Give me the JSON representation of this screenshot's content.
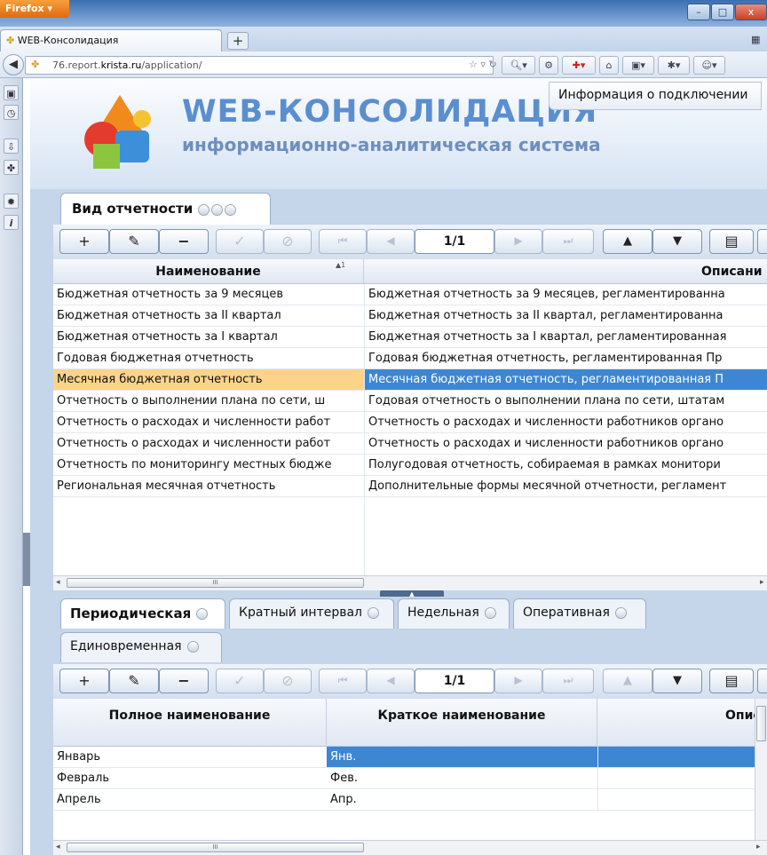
{
  "browser": {
    "menu_label": "Firefox",
    "tab_title": "WEB-Консолидация",
    "url_prefix": "76.report.",
    "url_domain": "krista.ru",
    "url_path": "/application/",
    "window_controls": [
      "–",
      "□",
      "x"
    ]
  },
  "header": {
    "title": "WEB-КОНСОЛИДАЦИЯ",
    "subtitle": "информационно-аналитическая система",
    "connection_info": "Информация о подключении"
  },
  "top_panel": {
    "tab_label": "Вид отчетности",
    "pager": "1/1",
    "columns": [
      "Наименование",
      "Описани"
    ],
    "sort_marker": "▲1",
    "rows": [
      {
        "name": "Бюджетная отчетность за 9 месяцев",
        "desc": "Бюджетная отчетность за 9 месяцев, регламентированна"
      },
      {
        "name": "Бюджетная отчетность за II квартал",
        "desc": "Бюджетная отчетность за II квартал, регламентированна"
      },
      {
        "name": "Бюджетная отчетность за I квартал",
        "desc": "Бюджетная отчетность за I квартал, регламентированная"
      },
      {
        "name": "Годовая бюджетная отчетность",
        "desc": "Годовая бюджетная отчетность, регламентированная Пр"
      },
      {
        "name": "Месячная бюджетная отчетность",
        "desc": "Месячная бюджетная отчетность, регламентированная П",
        "selected": true
      },
      {
        "name": "Отчетность о выполнении плана по сети, ш",
        "desc": "Годовая отчетность о выполнении плана по сети, штатам"
      },
      {
        "name": "Отчетность о расходах и численности работ",
        "desc": "Отчетность о расходах и численности работников органо"
      },
      {
        "name": "Отчетность о расходах и численности работ",
        "desc": "Отчетность о расходах и численности работников органо"
      },
      {
        "name": "Отчетность по мониторингу местных бюдже",
        "desc": "Полугодовая отчетность, собираемая в рамках монитори"
      },
      {
        "name": "Региональная месячная отчетность",
        "desc": "Дополнительные формы месячной отчетности, регламент"
      }
    ],
    "scroll_mark": "III"
  },
  "bottom_panel": {
    "tabs": [
      {
        "label": "Периодическая",
        "active": true
      },
      {
        "label": "Кратный интервал"
      },
      {
        "label": "Недельная"
      },
      {
        "label": "Оперативная"
      },
      {
        "label": "Единовременная"
      }
    ],
    "pager": "1/1",
    "columns": [
      "Полное наименование",
      "Краткое наименование",
      "Описа"
    ],
    "rows": [
      {
        "full": "Январь",
        "short": "Янв.",
        "selected": true
      },
      {
        "full": "Февраль",
        "short": "Фев."
      },
      {
        "full": "Апрель",
        "short": "Апр."
      }
    ],
    "scroll_mark": "III"
  },
  "toolbar": {
    "add": "+",
    "edit": "✎",
    "remove": "−",
    "apply": "✓",
    "cancel": "⊘",
    "first": "⏮",
    "prev": "◀",
    "next": "▶",
    "last": "⏭",
    "up": "▲",
    "down": "▼",
    "list": "▤"
  }
}
